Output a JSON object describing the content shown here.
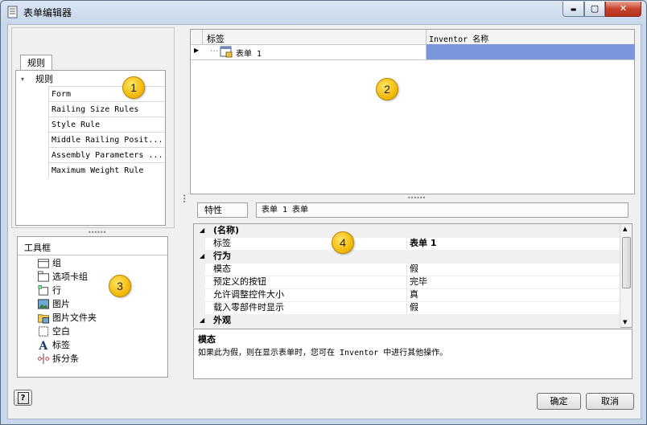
{
  "window": {
    "title": "表单编辑器",
    "minimize": "▬",
    "maximize": "▢",
    "close": "✕"
  },
  "rules_panel": {
    "tab_label": "规则",
    "root_label": "规则",
    "items": [
      "Form",
      "Railing Size Rules",
      "Style Rule",
      "Middle Railing Posit...",
      "Assembly Parameters ...",
      "Maximum Weight Rule"
    ]
  },
  "toolbox": {
    "header": "工具框",
    "items": [
      {
        "label": "组",
        "icon": "group-icon"
      },
      {
        "label": "选项卡组",
        "icon": "tab-group-icon"
      },
      {
        "label": "行",
        "icon": "row-icon"
      },
      {
        "label": "图片",
        "icon": "picture-icon"
      },
      {
        "label": "图片文件夹",
        "icon": "picture-folder-icon"
      },
      {
        "label": "空白",
        "icon": "blank-icon"
      },
      {
        "label": "标签",
        "icon": "label-icon"
      },
      {
        "label": "拆分条",
        "icon": "splitter-icon"
      }
    ]
  },
  "form_grid": {
    "col_label": "标签",
    "col_inventor": "Inventor 名称",
    "row_label": "表单 1",
    "row_marker": "▶"
  },
  "properties": {
    "header_label": "特性",
    "header_value": "表单 1  表单",
    "rows": [
      {
        "type": "category",
        "label": "(名称)"
      },
      {
        "type": "prop",
        "label": "标签",
        "value": "表单 1",
        "bold": true
      },
      {
        "type": "category",
        "label": "行为"
      },
      {
        "type": "prop",
        "label": "模态",
        "value": "假"
      },
      {
        "type": "prop",
        "label": "预定义的按钮",
        "value": "完毕"
      },
      {
        "type": "prop",
        "label": "允许调整控件大小",
        "value": "真"
      },
      {
        "type": "prop",
        "label": "载入零部件时显示",
        "value": "假"
      },
      {
        "type": "category",
        "label": "外观"
      }
    ],
    "desc_title": "模态",
    "desc_text": "如果此为假，则在显示表单时，您可在 Inventor 中进行其他操作。"
  },
  "callouts": [
    "1",
    "2",
    "3",
    "4"
  ],
  "footer": {
    "help": "?",
    "ok": "确定",
    "cancel": "取消"
  },
  "colors": {
    "selection": "#7b96dc",
    "badge": "#f2b400"
  }
}
